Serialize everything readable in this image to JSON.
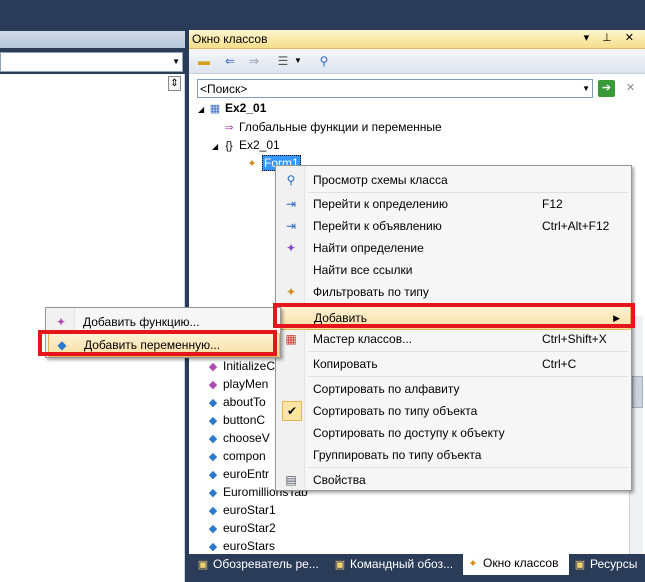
{
  "class_view": {
    "title": "Окно классов",
    "title_buttons": "▾ ⊥ ✕",
    "search": {
      "value": "<Поиск>"
    },
    "tree": [
      {
        "label": "Ex2_01",
        "icon": "project-icon",
        "bold": true
      },
      {
        "label": "Глобальные функции и переменные",
        "icon": "globals-icon"
      },
      {
        "label": "Ex2_01",
        "icon": "namespace-icon"
      },
      {
        "label": "Form1",
        "icon": "class-icon",
        "selected": true
      }
    ],
    "members": [
      "InitializeC",
      "playMen",
      "aboutTo",
      "buttonC",
      "chooseV",
      "compon",
      "euroEntr",
      "EuromillionsTab",
      "euroStar1",
      "euroStar2",
      "euroStars"
    ]
  },
  "context_menu": {
    "items": [
      {
        "label": "Просмотр схемы класса",
        "shortcut": "",
        "icon": "class-diagram-icon"
      },
      {
        "label": "Перейти к определению",
        "shortcut": "F12",
        "icon": "go-to-definition-icon"
      },
      {
        "label": "Перейти к объявлению",
        "shortcut": "Ctrl+Alt+F12",
        "icon": "go-to-declaration-icon"
      },
      {
        "label": "Найти определение",
        "shortcut": "",
        "icon": "find-definition-icon"
      },
      {
        "label": "Найти все ссылки",
        "shortcut": "",
        "icon": ""
      },
      {
        "label": "Фильтровать по типу",
        "shortcut": "",
        "icon": "filter-icon"
      },
      {
        "label": "Добавить",
        "shortcut": "",
        "icon": "",
        "submenu": true
      },
      {
        "label": "Мастер классов...",
        "shortcut": "Ctrl+Shift+X",
        "icon": "class-wizard-icon"
      },
      {
        "label": "Копировать",
        "shortcut": "Ctrl+C",
        "icon": ""
      },
      {
        "label": "Сортировать по алфавиту",
        "shortcut": "",
        "icon": ""
      },
      {
        "label": "Сортировать по типу объекта",
        "shortcut": "",
        "icon": "checkmark-icon",
        "checked": true
      },
      {
        "label": "Сортировать по доступу к объекту",
        "shortcut": "",
        "icon": ""
      },
      {
        "label": "Группировать по типу объекта",
        "shortcut": "",
        "icon": ""
      },
      {
        "label": "Свойства",
        "shortcut": "",
        "icon": "properties-icon"
      }
    ]
  },
  "submenu": {
    "items": [
      {
        "label": "Добавить функцию...",
        "icon": "add-function-icon"
      },
      {
        "label": "Добавить переменную...",
        "icon": "add-variable-icon"
      }
    ]
  },
  "tabs": [
    {
      "label": "Обозреватель ре...",
      "active": false
    },
    {
      "label": "Командный обоз...",
      "active": false
    },
    {
      "label": "Окно классов",
      "active": true
    },
    {
      "label": "Ресурсы",
      "active": false
    }
  ],
  "colors": {
    "highlight_border": "#e5161b",
    "title_gradient": "#f5dd8a",
    "selection": "#3399ff"
  }
}
